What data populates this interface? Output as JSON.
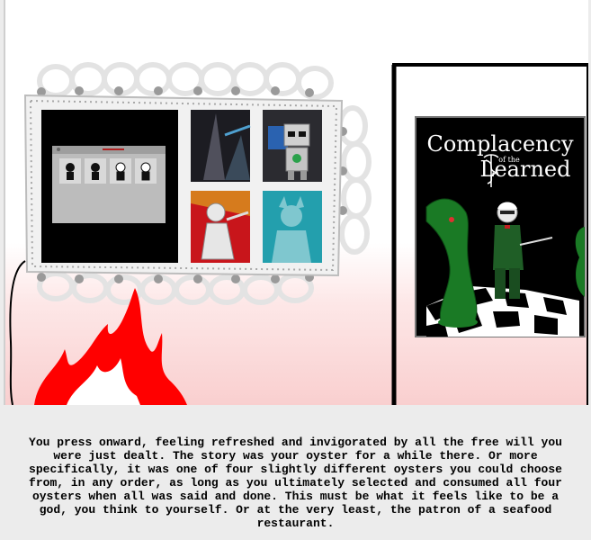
{
  "poster": {
    "title_line1": "Complacency",
    "title_small": "of the",
    "title_line2": "Learned"
  },
  "narration": "You press onward, feeling refreshed and invigorated by all the free will you were just dealt. The story was your oyster for a while there. Or more specifically, it was one of four slightly different oysters you could choose from, in any order, as long as you ultimately selected and consumed all four oysters when all was said and done. This must be what it feels like to be a god, you think to yourself. Or at the very least, the patron of a seafood restaurant.",
  "colors": {
    "fire": "#ff0000",
    "poster_bg": "#000000",
    "text": "#000000",
    "footer_bg": "#ececec"
  }
}
